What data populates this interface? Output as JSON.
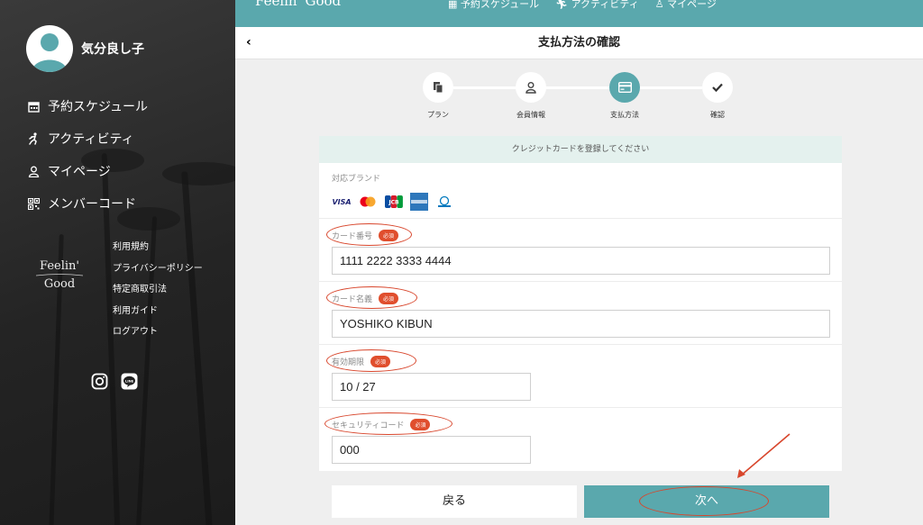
{
  "user": {
    "name": "気分良し子"
  },
  "nav": {
    "items": [
      {
        "label": "予約スケジュール",
        "icon": "calendar-icon"
      },
      {
        "label": "アクティビティ",
        "icon": "running-icon"
      },
      {
        "label": "マイページ",
        "icon": "person-icon"
      },
      {
        "label": "メンバーコード",
        "icon": "qr-code-icon"
      }
    ]
  },
  "brand": {
    "line1": "Feelin'",
    "line2": "Good"
  },
  "footer_links": [
    "利用規約",
    "プライバシーポリシー",
    "特定商取引法",
    "利用ガイド",
    "ログアウト"
  ],
  "topbar": {
    "logo": "Feelin' Good",
    "nav": [
      "予約スケジュール",
      "アクティビティ",
      "マイページ"
    ]
  },
  "header": {
    "back": "‹",
    "title": "支払方法の確認"
  },
  "steps": [
    {
      "label": "プラン",
      "icon": "document-icon",
      "active": false
    },
    {
      "label": "会員情報",
      "icon": "person-icon",
      "active": false
    },
    {
      "label": "支払方法",
      "icon": "credit-card-icon",
      "active": true
    },
    {
      "label": "確認",
      "icon": "check-icon",
      "active": false
    }
  ],
  "card": {
    "banner": "クレジットカードを登録してください",
    "brands_title": "対応ブランド",
    "brands": [
      "VISA",
      "Mastercard",
      "JCB",
      "AMEX",
      "Diners Club"
    ],
    "required_badge": "必須",
    "fields": {
      "number": {
        "label": "カード番号",
        "value": "1111 2222 3333 4444"
      },
      "name": {
        "label": "カード名義",
        "value": "YOSHIKO KIBUN"
      },
      "expiry": {
        "label": "有効期限",
        "value": "10 / 27"
      },
      "cvc": {
        "label": "セキュリティコード",
        "value": "000"
      }
    }
  },
  "buttons": {
    "back": "戻る",
    "next": "次へ"
  },
  "colors": {
    "accent": "#5aa8ad",
    "annotation": "#d8462c",
    "required": "#e04e2d"
  }
}
